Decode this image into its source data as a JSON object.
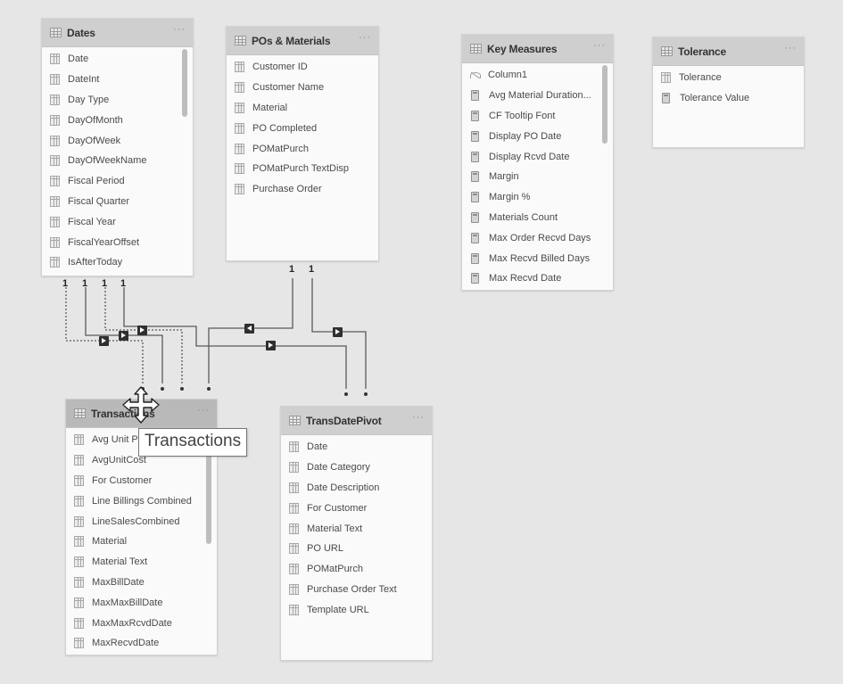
{
  "tables": {
    "dates": {
      "title": "Dates",
      "more_label": "···",
      "fields": [
        {
          "label": "Date",
          "icon": "column-icon"
        },
        {
          "label": "DateInt",
          "icon": "column-icon"
        },
        {
          "label": "Day Type",
          "icon": "column-icon"
        },
        {
          "label": "DayOfMonth",
          "icon": "column-icon"
        },
        {
          "label": "DayOfWeek",
          "icon": "column-icon"
        },
        {
          "label": "DayOfWeekName",
          "icon": "column-icon"
        },
        {
          "label": "Fiscal Period",
          "icon": "column-icon"
        },
        {
          "label": "Fiscal Quarter",
          "icon": "column-icon"
        },
        {
          "label": "Fiscal Year",
          "icon": "column-icon"
        },
        {
          "label": "FiscalYearOffset",
          "icon": "column-icon"
        },
        {
          "label": "IsAfterToday",
          "icon": "column-icon"
        }
      ]
    },
    "pos_materials": {
      "title": "POs & Materials",
      "more_label": "···",
      "fields": [
        {
          "label": "Customer ID",
          "icon": "column-icon"
        },
        {
          "label": "Customer Name",
          "icon": "column-icon"
        },
        {
          "label": "Material",
          "icon": "column-icon"
        },
        {
          "label": "PO Completed",
          "icon": "column-icon"
        },
        {
          "label": "POMatPurch",
          "icon": "column-icon"
        },
        {
          "label": "POMatPurch TextDisp",
          "icon": "column-icon"
        },
        {
          "label": "Purchase Order",
          "icon": "column-icon"
        }
      ]
    },
    "key_measures": {
      "title": "Key Measures",
      "more_label": "···",
      "fields": [
        {
          "label": "Column1",
          "icon": "hidden-column-icon"
        },
        {
          "label": "Avg Material Duration...",
          "icon": "measure-icon"
        },
        {
          "label": "CF Tooltip Font",
          "icon": "measure-icon"
        },
        {
          "label": "Display PO Date",
          "icon": "measure-icon"
        },
        {
          "label": "Display Rcvd Date",
          "icon": "measure-icon"
        },
        {
          "label": "Margin",
          "icon": "measure-icon"
        },
        {
          "label": "Margin %",
          "icon": "measure-icon"
        },
        {
          "label": "Materials Count",
          "icon": "measure-icon"
        },
        {
          "label": "Max Order Recvd Days",
          "icon": "measure-icon"
        },
        {
          "label": "Max Recvd Billed Days",
          "icon": "measure-icon"
        },
        {
          "label": "Max Recvd Date",
          "icon": "measure-icon"
        }
      ]
    },
    "tolerance": {
      "title": "Tolerance",
      "more_label": "···",
      "fields": [
        {
          "label": "Tolerance",
          "icon": "column-icon"
        },
        {
          "label": "Tolerance Value",
          "icon": "measure-icon"
        }
      ]
    },
    "transactions": {
      "title": "Transactions",
      "more_label": "···",
      "fields": [
        {
          "label": "Avg Unit Price",
          "icon": "column-icon"
        },
        {
          "label": "AvgUnitCost",
          "icon": "column-icon"
        },
        {
          "label": "For Customer",
          "icon": "column-icon"
        },
        {
          "label": "Line Billings Combined",
          "icon": "column-icon"
        },
        {
          "label": "LineSalesCombined",
          "icon": "column-icon"
        },
        {
          "label": "Material",
          "icon": "column-icon"
        },
        {
          "label": "Material Text",
          "icon": "column-icon"
        },
        {
          "label": "MaxBillDate",
          "icon": "column-icon"
        },
        {
          "label": "MaxMaxBillDate",
          "icon": "column-icon"
        },
        {
          "label": "MaxMaxRcvdDate",
          "icon": "column-icon"
        },
        {
          "label": "MaxRecvdDate",
          "icon": "column-icon"
        }
      ]
    },
    "trans_date_pivot": {
      "title": "TransDatePivot",
      "more_label": "···",
      "fields": [
        {
          "label": "Date",
          "icon": "column-icon"
        },
        {
          "label": "Date Category",
          "icon": "column-icon"
        },
        {
          "label": "Date Description",
          "icon": "column-icon"
        },
        {
          "label": "For Customer",
          "icon": "column-icon"
        },
        {
          "label": "Material Text",
          "icon": "column-icon"
        },
        {
          "label": "PO URL",
          "icon": "column-icon"
        },
        {
          "label": "POMatPurch",
          "icon": "column-icon"
        },
        {
          "label": "Purchase Order Text",
          "icon": "column-icon"
        },
        {
          "label": "Template URL",
          "icon": "column-icon"
        }
      ]
    }
  },
  "relationships": {
    "one_label": "1",
    "many_label": "*",
    "items": [
      {
        "from": "Dates",
        "to": "Transactions",
        "cardinality": "1:*",
        "active": false,
        "direction": "single"
      },
      {
        "from": "Dates",
        "to": "Transactions",
        "cardinality": "1:*",
        "active": true,
        "direction": "single"
      },
      {
        "from": "Dates",
        "to": "Transactions",
        "cardinality": "1:*",
        "active": false,
        "direction": "single"
      },
      {
        "from": "Dates",
        "to": "TransDatePivot",
        "cardinality": "1:*",
        "active": true,
        "direction": "single"
      },
      {
        "from": "POs & Materials",
        "to": "Transactions",
        "cardinality": "1:*",
        "active": true,
        "direction": "single"
      },
      {
        "from": "POs & Materials",
        "to": "TransDatePivot",
        "cardinality": "1:*",
        "active": true,
        "direction": "single"
      }
    ]
  },
  "tooltip": {
    "text": "Transactions"
  },
  "colors": {
    "canvas": "#e6e6e6",
    "header": "#cfcfcf",
    "header_selected": "#b9b9b9",
    "card": "#fafafa",
    "line": "#555555"
  }
}
